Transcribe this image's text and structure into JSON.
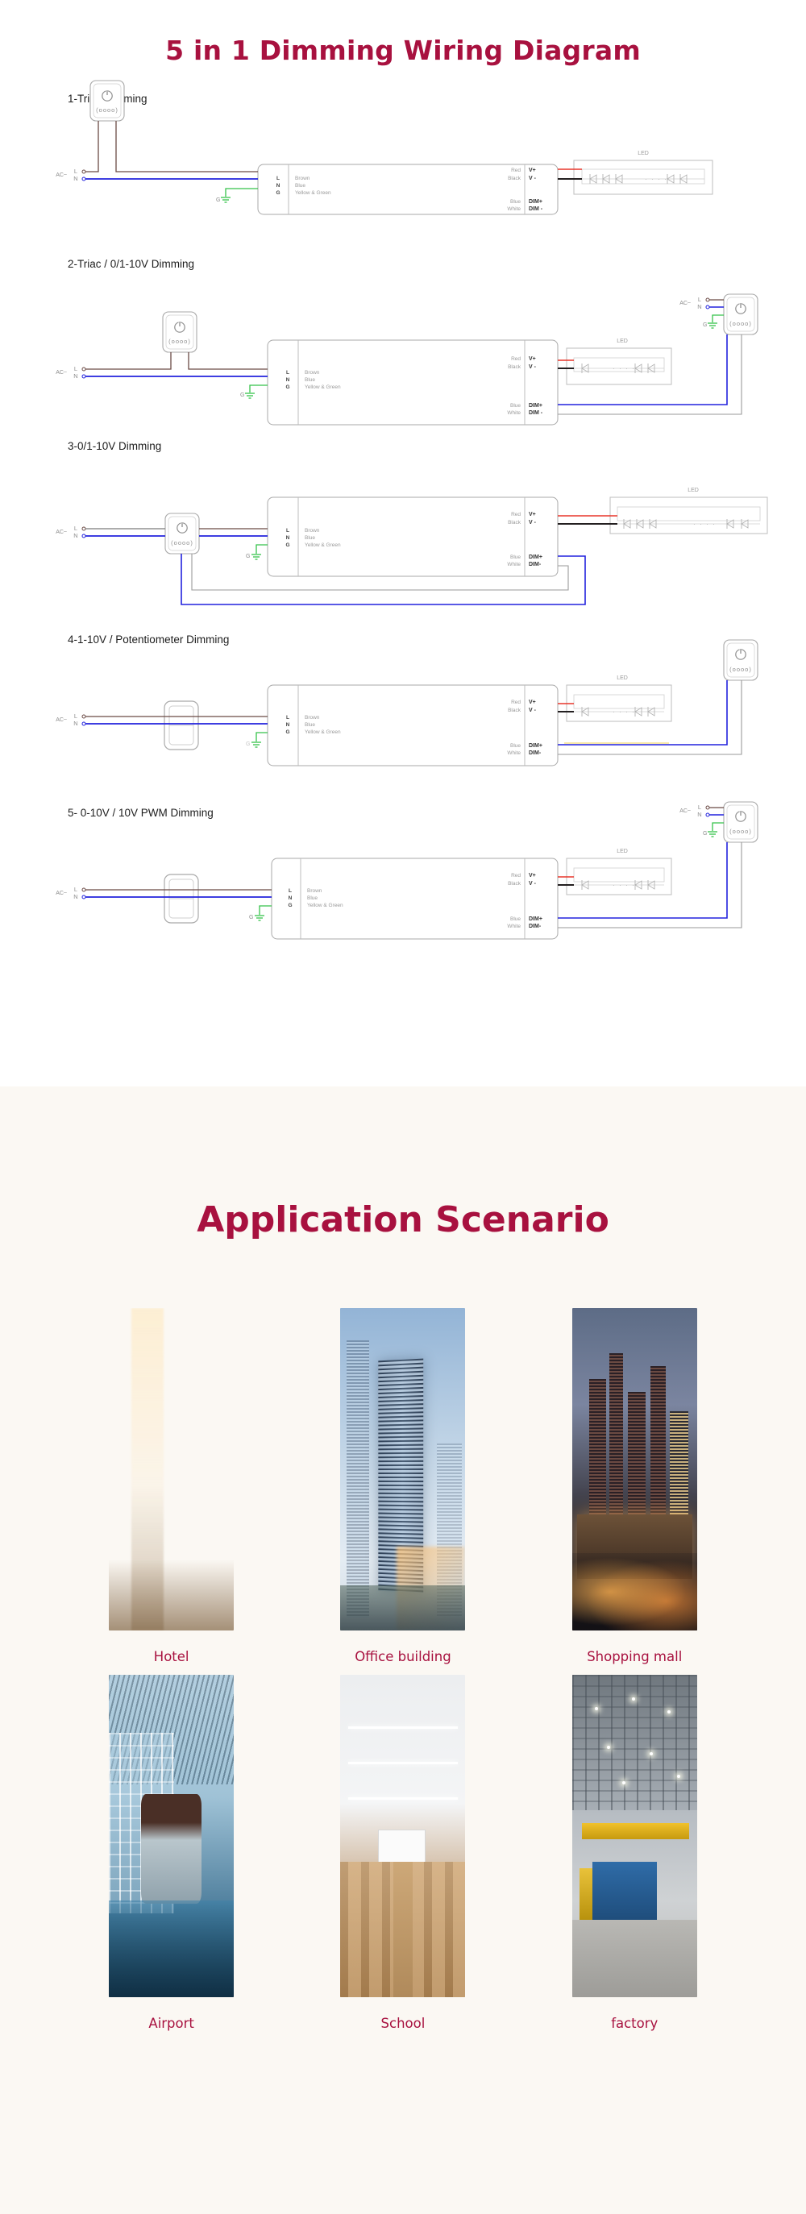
{
  "colors": {
    "brand": "#a8113f",
    "section_bg": "#fbf8f3",
    "wire_live": "#6b4a45",
    "wire_neutral": "#2222dd",
    "wire_ground": "#35c24a",
    "wire_red": "#e8372b",
    "wire_black": "#231f20",
    "label_grey": "#8c8c8c",
    "outline": "#a9a9a9"
  },
  "wiring": {
    "title": "5 in 1 Dimming Wiring Diagram",
    "common": {
      "ac_label": "AC~",
      "ac_l": "L",
      "ac_n": "N",
      "ground": "G",
      "driver_terminals": [
        "L",
        "N",
        "G"
      ],
      "driver_wire_colors": [
        "Brown",
        "Blue",
        "Yellow & Green"
      ],
      "out_wire_colors": [
        "Red",
        "Black"
      ],
      "out_terminals": [
        "V+",
        "V -"
      ],
      "dim_wire_colors": [
        "Blue",
        "White"
      ],
      "dim_terminals": [
        "DIM+",
        "DIM -"
      ],
      "led_label": "LED",
      "switch_dots": "(oooo)"
    },
    "diagrams": [
      {
        "id": 1,
        "label": "1-Triac Dimming"
      },
      {
        "id": 2,
        "label": "2-Triac / 0/1-10V Dimming"
      },
      {
        "id": 3,
        "label": "3-0/1-10V Dimming"
      },
      {
        "id": 4,
        "label": "4-1-10V / Potentiometer Dimming"
      },
      {
        "id": 5,
        "label": "5- 0-10V / 10V PWM Dimming"
      }
    ]
  },
  "application": {
    "title": "Application Scenario",
    "scenarios": [
      {
        "caption": "Hotel",
        "art": "ph-hotel"
      },
      {
        "caption": "Office building",
        "art": "ph-office"
      },
      {
        "caption": "Shopping mall",
        "art": "ph-mall"
      },
      {
        "caption": "Airport",
        "art": "ph-airport"
      },
      {
        "caption": "School",
        "art": "ph-school"
      },
      {
        "caption": "factory",
        "art": "ph-factory"
      }
    ]
  }
}
